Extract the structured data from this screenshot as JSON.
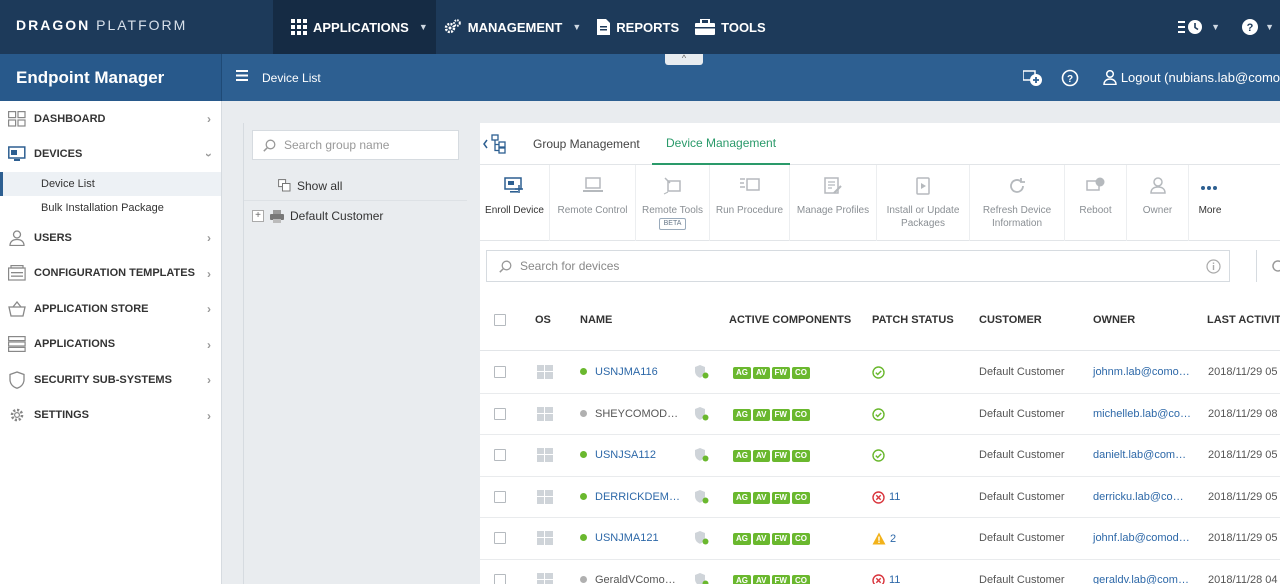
{
  "topbar": {
    "brand_bold": "DRAGON",
    "brand_light": " PLATFORM",
    "nav": [
      {
        "label": "APPLICATIONS",
        "icon": "grid-icon",
        "has_caret": true
      },
      {
        "label": "MANAGEMENT",
        "icon": "gears-icon",
        "has_caret": true
      },
      {
        "label": "REPORTS",
        "icon": "report-icon",
        "has_caret": false
      },
      {
        "label": "TOOLS",
        "icon": "toolbox-icon",
        "has_caret": false
      }
    ]
  },
  "subbar": {
    "app_title": "Endpoint Manager",
    "breadcrumb": "Device List",
    "logout_label": "Logout (nubians.lab@como"
  },
  "sidebar": {
    "items": [
      {
        "label": "DASHBOARD",
        "icon": "dashboard-icon"
      },
      {
        "label": "DEVICES",
        "icon": "devices-icon"
      },
      {
        "label": "USERS",
        "icon": "user-icon"
      },
      {
        "label": "CONFIGURATION TEMPLATES",
        "icon": "templates-icon"
      },
      {
        "label": "APPLICATION STORE",
        "icon": "basket-icon"
      },
      {
        "label": "APPLICATIONS",
        "icon": "applications-icon"
      },
      {
        "label": "SECURITY SUB-SYSTEMS",
        "icon": "shield-icon"
      },
      {
        "label": "SETTINGS",
        "icon": "gear-icon"
      }
    ],
    "devices_sub": [
      "Device List",
      "Bulk Installation Package"
    ]
  },
  "groups": {
    "search_placeholder": "Search group name",
    "show_all": "Show all",
    "default_customer": "Default Customer"
  },
  "main": {
    "tabs": [
      "Group Management",
      "Device Management"
    ],
    "tools": [
      {
        "label": "Enroll Device",
        "enabled": true
      },
      {
        "label": "Remote Control",
        "enabled": false
      },
      {
        "label": "Remote Tools",
        "enabled": false,
        "beta": "BETA"
      },
      {
        "label": "Run Procedure",
        "enabled": false
      },
      {
        "label": "Manage Profiles",
        "enabled": false
      },
      {
        "label": "Install or Update Packages",
        "enabled": false
      },
      {
        "label": "Refresh Device Information",
        "enabled": false
      },
      {
        "label": "Reboot",
        "enabled": false
      },
      {
        "label": "Owner",
        "enabled": false
      },
      {
        "label": "More",
        "enabled": true
      }
    ],
    "device_search_placeholder": "Search for devices",
    "columns": [
      "OS",
      "NAME",
      "ACTIVE COMPONENTS",
      "PATCH STATUS",
      "CUSTOMER",
      "OWNER",
      "LAST ACTIVITY"
    ],
    "rows": [
      {
        "name": "USNJMA116",
        "online": true,
        "patch": "ok",
        "patch_count": "",
        "customer": "Default Customer",
        "owner": "johnm.lab@como…",
        "last": "2018/11/29 05"
      },
      {
        "name": "SHEYCOMOD…",
        "online": false,
        "patch": "ok",
        "patch_count": "",
        "customer": "Default Customer",
        "owner": "michelleb.lab@co…",
        "last": "2018/11/29 08"
      },
      {
        "name": "USNJSA112",
        "online": true,
        "patch": "ok",
        "patch_count": "",
        "customer": "Default Customer",
        "owner": "danielt.lab@com…",
        "last": "2018/11/29 05"
      },
      {
        "name": "DERRICKDEM…",
        "online": true,
        "patch": "error",
        "patch_count": "11",
        "customer": "Default Customer",
        "owner": "derricku.lab@co…",
        "last": "2018/11/29 05"
      },
      {
        "name": "USNJMA121",
        "online": true,
        "patch": "warn",
        "patch_count": "2",
        "customer": "Default Customer",
        "owner": "johnf.lab@comod…",
        "last": "2018/11/29 05"
      },
      {
        "name": "GeraldVComo…",
        "online": false,
        "patch": "error",
        "patch_count": "11",
        "customer": "Default Customer",
        "owner": "geraldv.lab@com…",
        "last": "2018/11/28 04"
      }
    ],
    "components": [
      "AG",
      "AV",
      "FW",
      "CO"
    ]
  },
  "colors": {
    "topbar": "#1d3a5a",
    "subbar": "#2d5f91",
    "accent_green": "#2a9a6a",
    "badge_green": "#6ab82e",
    "online": "#6ab82e",
    "offline": "#b0b0b0",
    "error": "#d9363e",
    "warn": "#f2b21a"
  }
}
